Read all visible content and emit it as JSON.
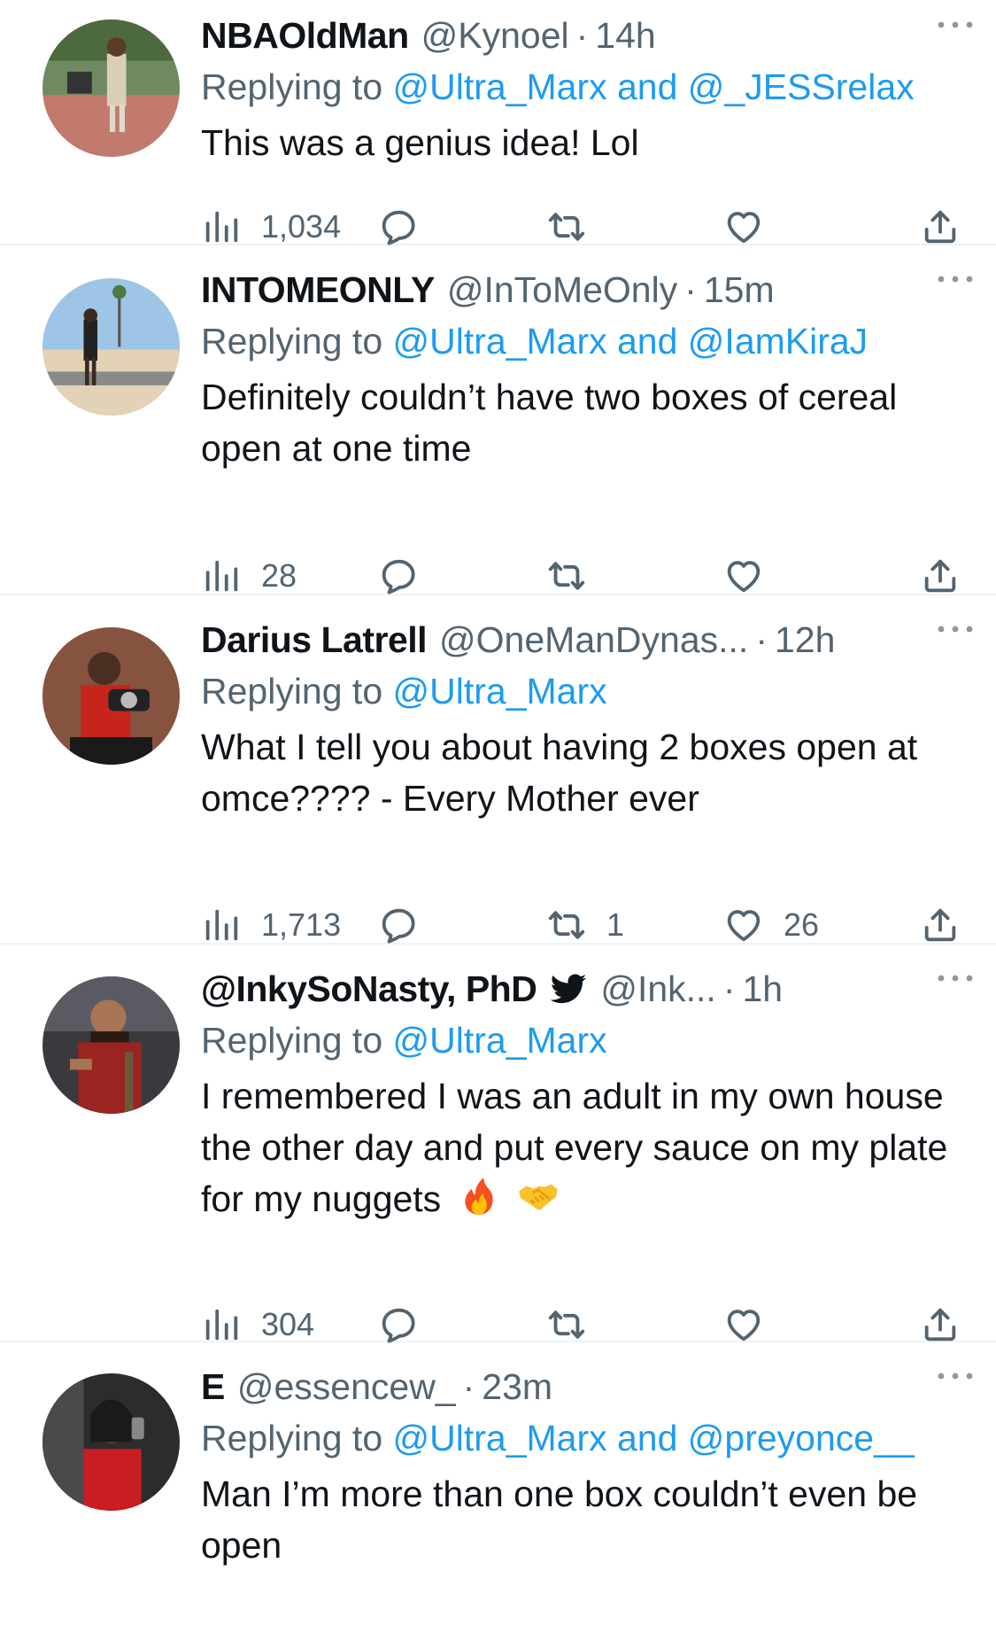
{
  "tweets": [
    {
      "name": "NBAOldMan",
      "handle": "@Kynoel",
      "time": "14h",
      "replying_prefix": "Replying to ",
      "replying_to": "@Ultra_Marx and @_JESSrelax",
      "text": "This was a genius idea! Lol",
      "views": "1,034",
      "replies": "",
      "retweets": "",
      "likes": ""
    },
    {
      "name": "INTOMEONLY",
      "handle": "@InToMeOnly",
      "time": "15m",
      "replying_prefix": "Replying to ",
      "replying_to": "@Ultra_Marx and @IamKiraJ",
      "text": "Definitely couldn’t have two boxes of cereal open at one time",
      "views": "28",
      "replies": "",
      "retweets": "",
      "likes": ""
    },
    {
      "name": "Darius Latrell",
      "handle": "@OneManDynas...",
      "time": "12h",
      "replying_prefix": "Replying to ",
      "replying_to": "@Ultra_Marx",
      "text": "What I tell you about having 2 boxes open at omce???? - Every Mother ever",
      "views": "1,713",
      "replies": "",
      "retweets": "1",
      "likes": "26"
    },
    {
      "name": "@InkySoNasty, PhD",
      "handle": "@Ink...",
      "time": "1h",
      "replying_prefix": "Replying to ",
      "replying_to": "@Ultra_Marx",
      "text": "I remembered I was an adult in my own house the other day and put every sauce on my plate for my nuggets",
      "views": "304",
      "replies": "",
      "retweets": "",
      "likes": ""
    },
    {
      "name": "E",
      "handle": "@essencew_",
      "time": "23m",
      "replying_prefix": "Replying to ",
      "replying_to": "@Ultra_Marx and @preyonce__",
      "text": "Man I’m more than one box couldn’t even be open"
    }
  ],
  "icons": {
    "views": "views-bar-chart-icon",
    "reply": "reply-bubble-icon",
    "retweet": "retweet-icon",
    "like": "heart-icon",
    "share": "share-upload-icon",
    "more": "more-dots-icon",
    "verified": "twitter-bird-badge-icon",
    "emoji_1": "fire-emoji",
    "emoji_2": "handshake-emoji"
  },
  "colors": {
    "text": "#0f1419",
    "secondary": "#536471",
    "accent": "#1d9bf0",
    "divider": "#eff3f4"
  }
}
